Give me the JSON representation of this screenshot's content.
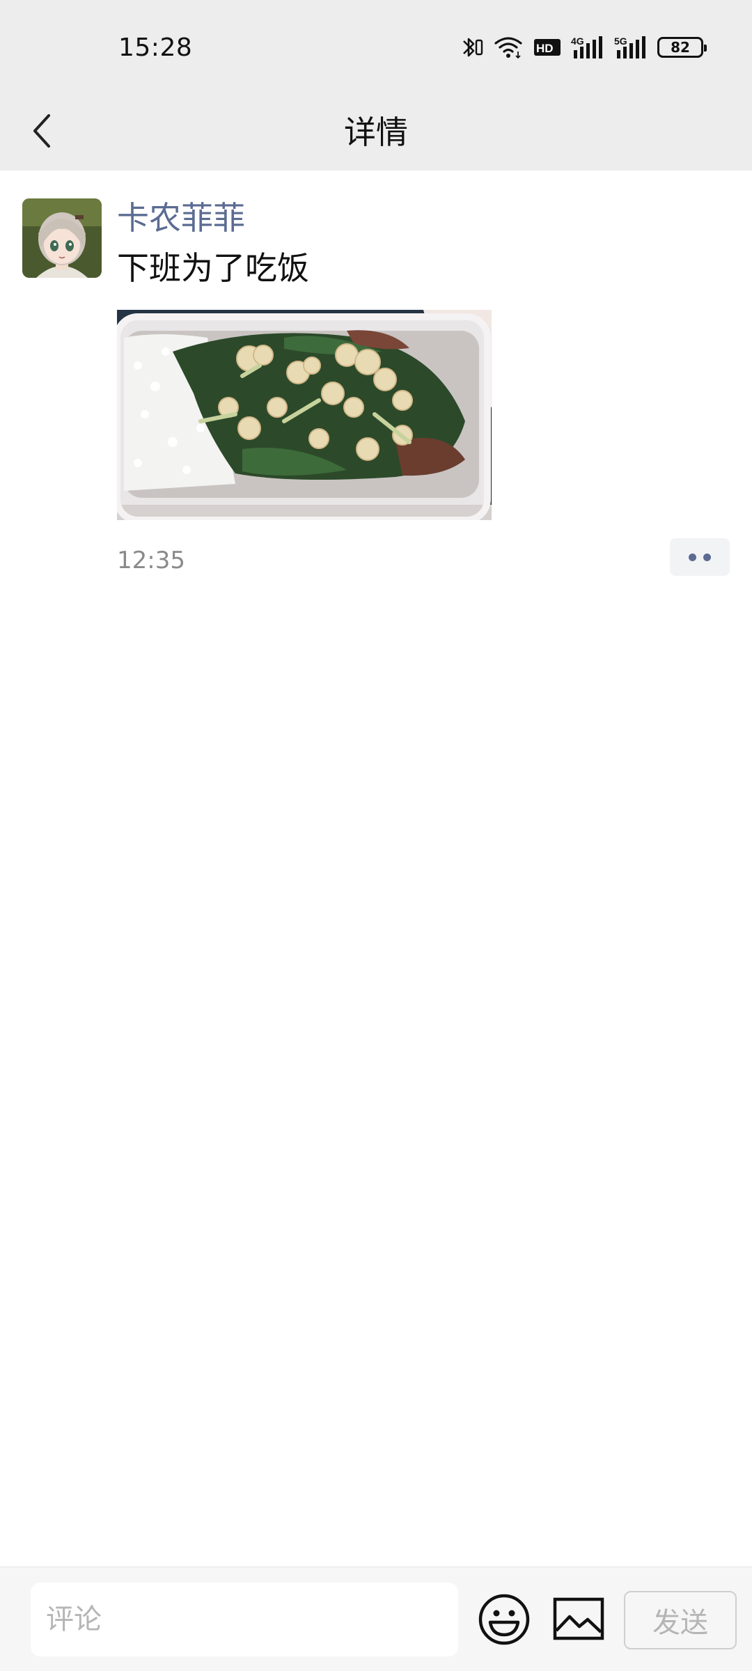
{
  "status_bar": {
    "time": "15:28",
    "icons": [
      "bluetooth-icon",
      "wifi-icon",
      "hd-icon",
      "signal-4g-icon",
      "signal-5g-icon"
    ],
    "network_4g": "4G",
    "network_5g": "5G",
    "hd": "HD",
    "battery": "82"
  },
  "header": {
    "title": "详情",
    "back_icon": "chevron-left-icon"
  },
  "post": {
    "author": "卡农菲菲",
    "text": "下班为了吃饭",
    "image_subject": "bento-box-rice-cauliflower-greens",
    "time": "12:35",
    "more_icon": "more-dots-icon"
  },
  "comment_bar": {
    "placeholder": "评论",
    "value": "",
    "emoji_icon": "smiley-icon",
    "image_icon": "image-icon",
    "send_label": "发送"
  },
  "colors": {
    "author_link": "#5b6b92",
    "header_bg": "#ededed",
    "comment_bar_bg": "#f6f6f6",
    "time_gray": "#8a8a8a",
    "send_disabled": "#b5b5b5"
  }
}
